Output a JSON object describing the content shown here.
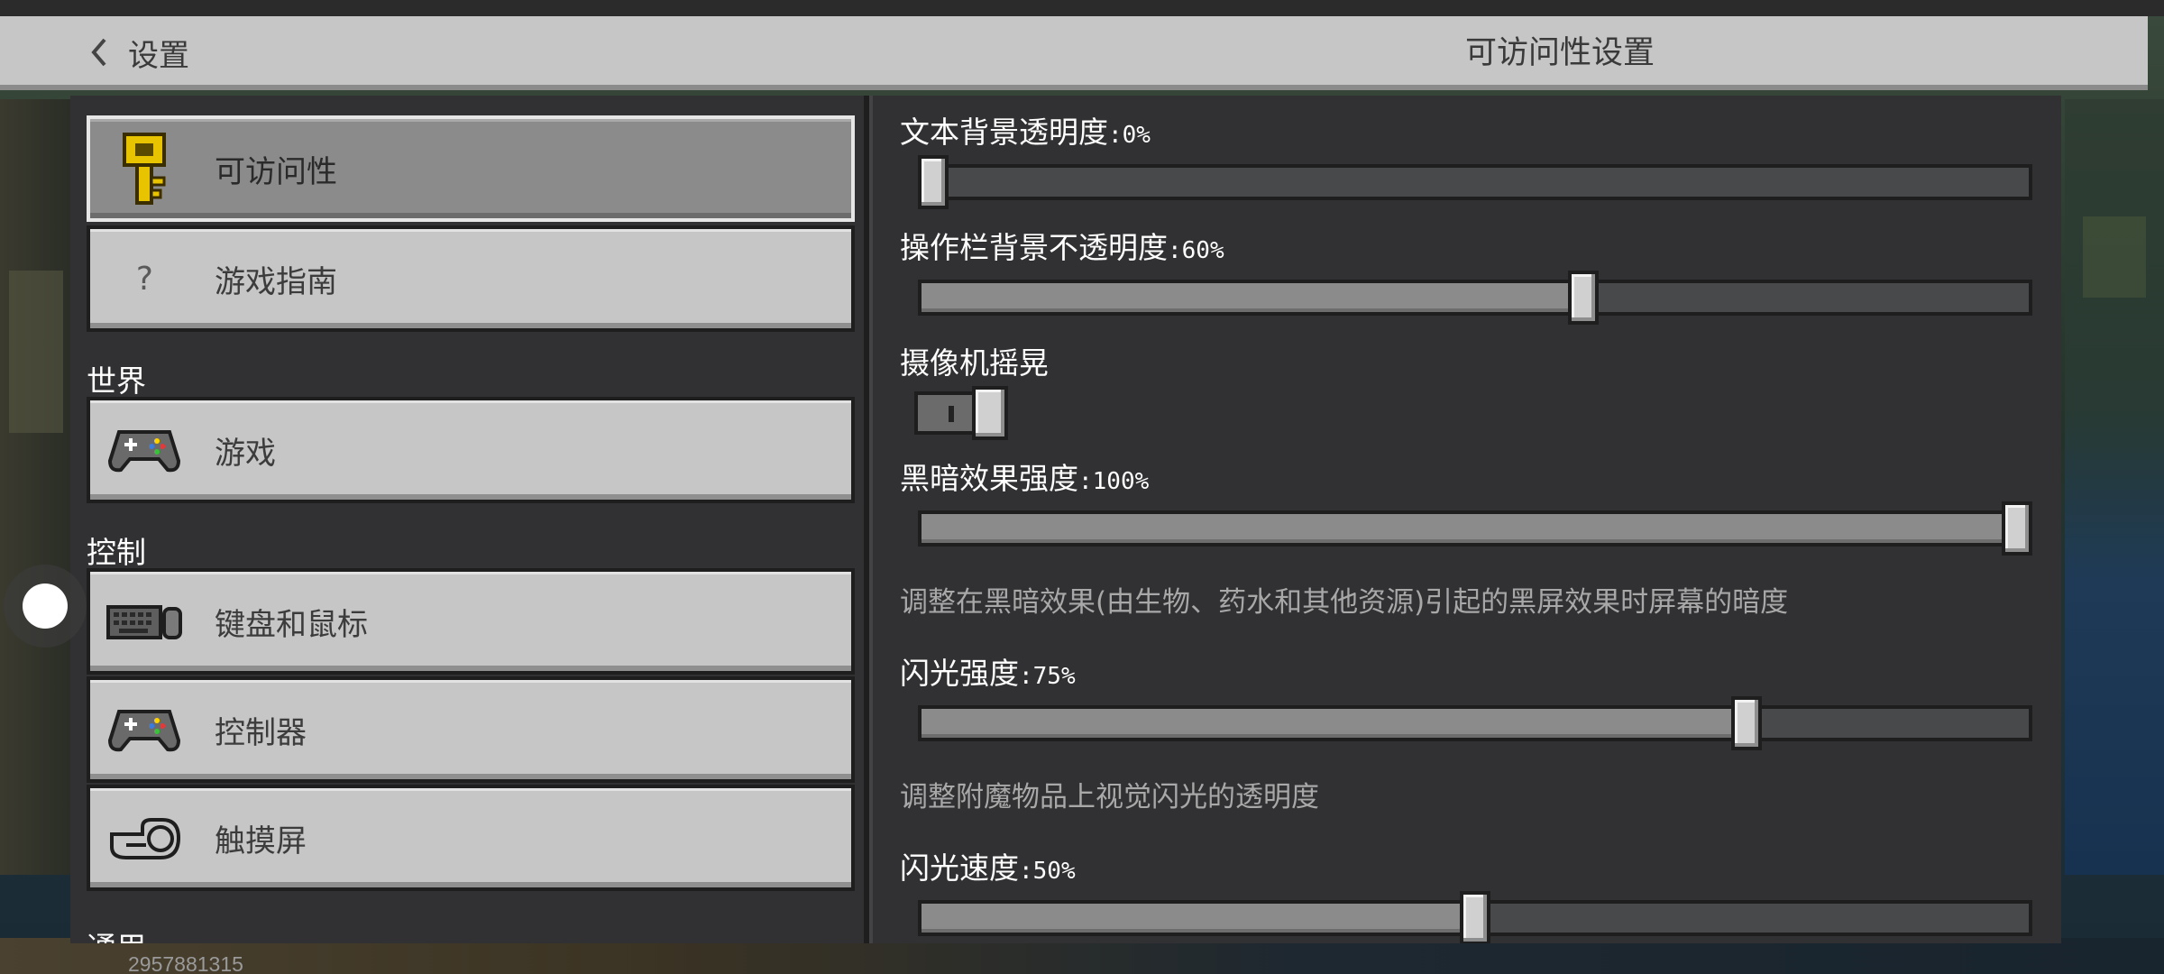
{
  "header": {
    "back_label": "设置",
    "title": "可访问性设置"
  },
  "sidebar": {
    "items": [
      {
        "label": "可访问性",
        "icon": "key-icon",
        "active": true
      },
      {
        "label": "游戏指南",
        "icon": "question-icon"
      }
    ],
    "sections": [
      {
        "title": "世界",
        "items": [
          {
            "label": "游戏",
            "icon": "gamepad-icon"
          }
        ]
      },
      {
        "title": "控制",
        "items": [
          {
            "label": "键盘和鼠标",
            "icon": "keyboard-mouse-icon"
          },
          {
            "label": "控制器",
            "icon": "gamepad-icon"
          },
          {
            "label": "触摸屏",
            "icon": "touch-hand-icon"
          }
        ]
      },
      {
        "title": "通用"
      }
    ]
  },
  "settings": {
    "text_bg_opacity": {
      "label": "文本背景透明度",
      "value_text": ":0%",
      "value": 0
    },
    "actionbar_bg_opacity": {
      "label": "操作栏背景不透明度",
      "value_text": ":60%",
      "value": 60
    },
    "camera_shake": {
      "label": "摄像机摇晃",
      "enabled": true
    },
    "darkness_strength": {
      "label": "黑暗效果强度",
      "value_text": ":100%",
      "value": 100,
      "description": "调整在黑暗效果(由生物、药水和其他资源)引起的黑屏效果时屏幕的暗度"
    },
    "glint_strength": {
      "label": "闪光强度",
      "value_text": ":75%",
      "value": 75,
      "description": "调整附魔物品上视觉闪光的透明度"
    },
    "glint_speed": {
      "label": "闪光速度",
      "value_text": ":50%",
      "value": 50
    }
  },
  "watermark": "2957881315",
  "colors": {
    "panel": "#313133",
    "button": "#c6c6c6",
    "button_active": "#8b8b8b",
    "slider_fill": "#8b8b8b",
    "slider_track": "#48494a"
  }
}
